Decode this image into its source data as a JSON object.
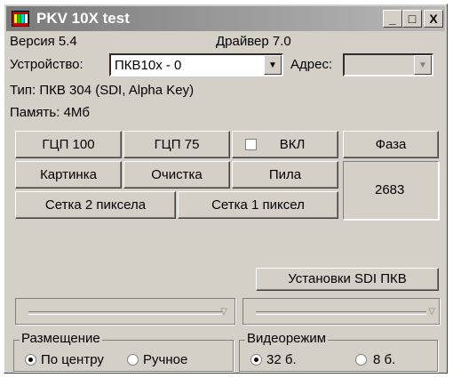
{
  "window": {
    "title": "PKV 10X test"
  },
  "titlebar_buttons": {
    "minimize": "_",
    "maximize": "□",
    "close": "X"
  },
  "info": {
    "version": "Версия 5.4",
    "driver": "Драйвер 7.0",
    "device_label": "Устройство:",
    "device_value": "ПКВ10х - 0",
    "address_label": "Адрес:",
    "address_value": "",
    "type": "Тип: ПКВ 304 (SDI, Alpha Key)",
    "memory": "Память: 4Мб"
  },
  "buttons": {
    "gcp100": "ГЦП 100",
    "gcp75": "ГЦП 75",
    "vkl": "ВКЛ",
    "faza": "Фаза",
    "kartinka": "Картинка",
    "ochistka": "Очистка",
    "pila": "Пила",
    "setka2": "Сетка 2 пиксела",
    "setka1": "Сетка 1 пиксел",
    "sdi": "Установки SDI ПКВ"
  },
  "counter": "2683",
  "vkl_checked": false,
  "placement": {
    "title": "Размещение",
    "center": "По центру",
    "manual": "Ручное",
    "selected": "center"
  },
  "videomode": {
    "title": "Видеорежим",
    "bit32": "32 б.",
    "bit8": "8 б.",
    "selected": "32"
  },
  "colors": {
    "titlebar": "#7a7a7a",
    "face": "#d4d0c8"
  }
}
